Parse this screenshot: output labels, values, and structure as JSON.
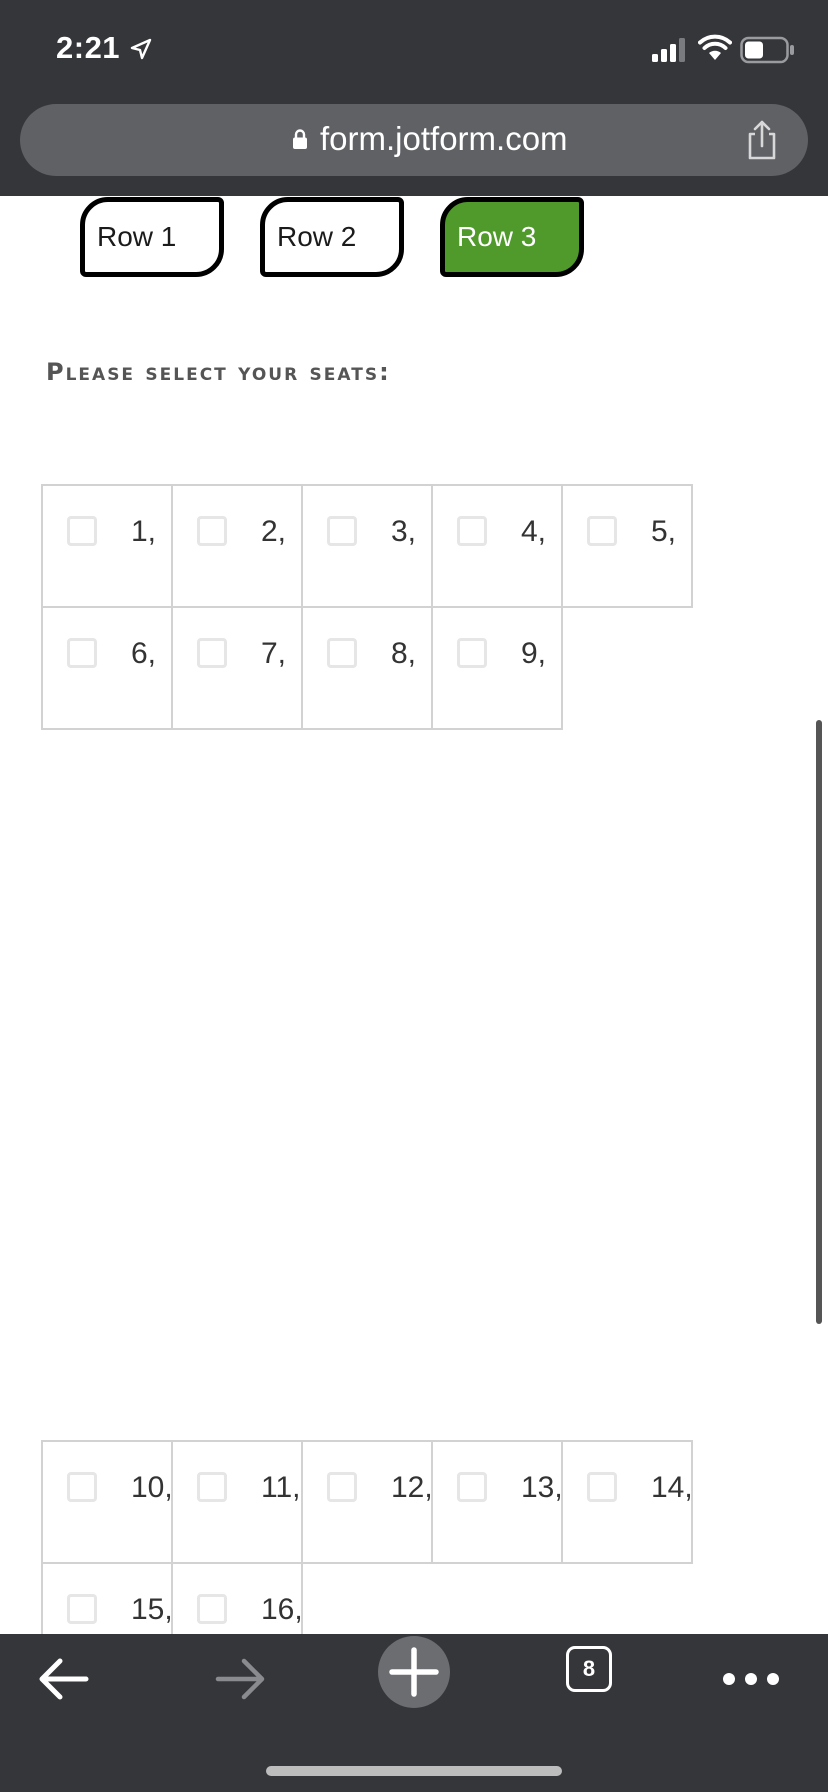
{
  "status_bar": {
    "time": "2:21",
    "icons": [
      "location-arrow-icon",
      "signal-bars-icon",
      "wifi-icon",
      "battery-icon"
    ]
  },
  "browser": {
    "url": "form.jotform.com",
    "open_tabs": "8"
  },
  "row_tabs": [
    {
      "label": "Row 1",
      "active": false
    },
    {
      "label": "Row 2",
      "active": false
    },
    {
      "label": "Row 3",
      "active": true
    }
  ],
  "colors": {
    "active_tab": "#4f9a2a",
    "chrome": "#35363a"
  },
  "heading": "Please select your seats:",
  "seat_groups": [
    {
      "seats": [
        "1,",
        "2,",
        "3,",
        "4,",
        "5,",
        "6,",
        "7,",
        "8,",
        "9,"
      ]
    },
    {
      "seats": [
        "10,",
        "11,",
        "12,",
        "13,",
        "14,",
        "15,",
        "16,"
      ]
    }
  ]
}
